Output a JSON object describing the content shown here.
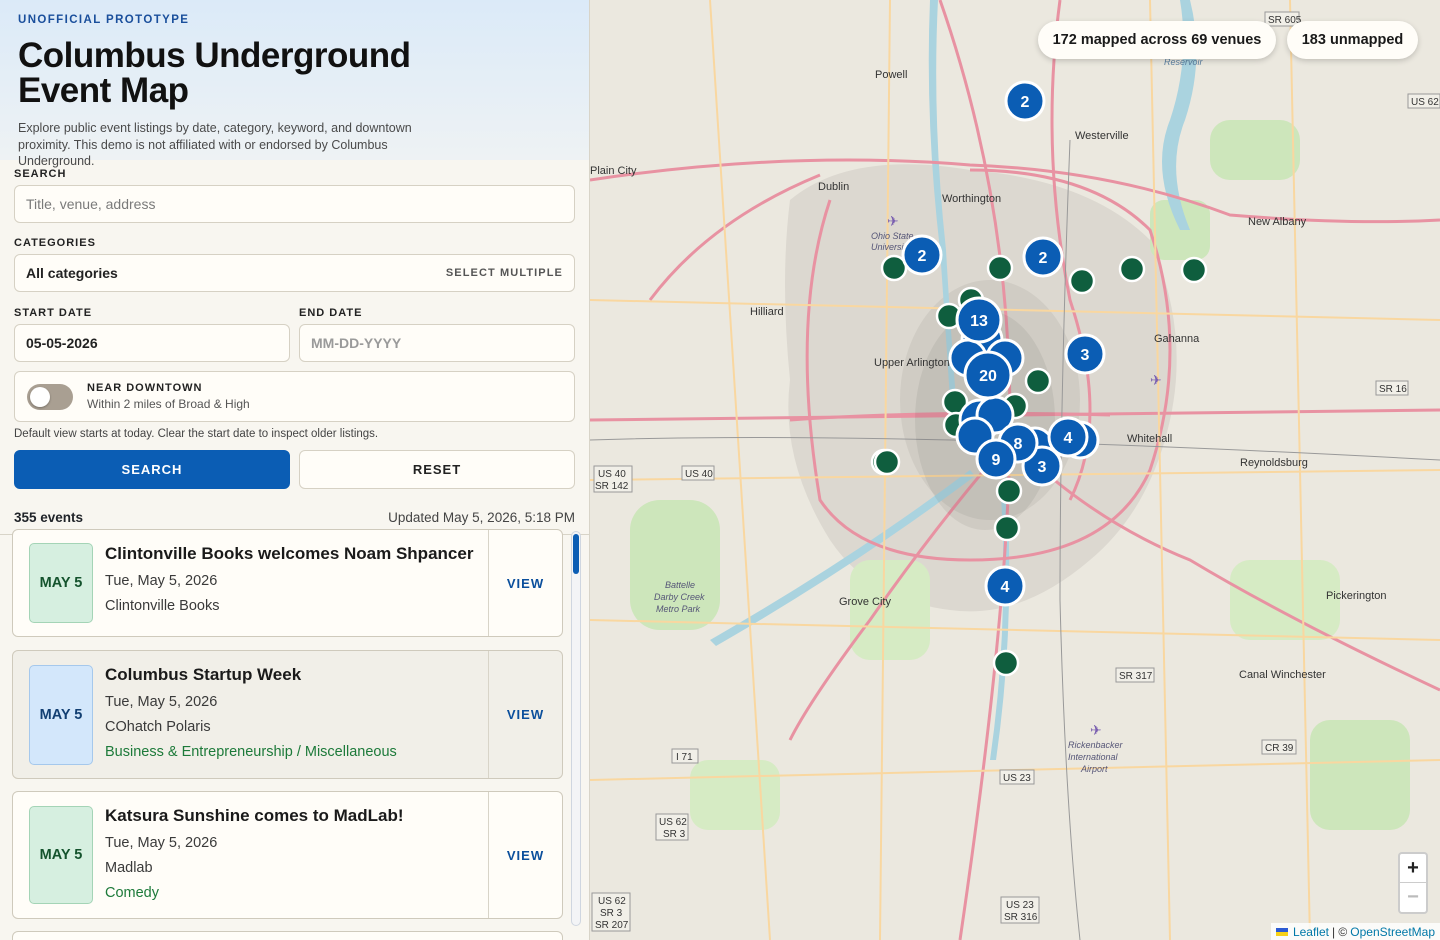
{
  "header": {
    "eyebrow": "UNOFFICIAL PROTOTYPE",
    "title": "Columbus Underground Event Map",
    "description": "Explore public event listings by date, category, keyword, and downtown proximity. This demo is not affiliated with or endorsed by Columbus Underground."
  },
  "search": {
    "label": "SEARCH",
    "placeholder": "Title, venue, address"
  },
  "categories": {
    "label": "CATEGORIES",
    "value": "All categories",
    "select_multiple": "SELECT MULTIPLE"
  },
  "dates": {
    "start_label": "START DATE",
    "start_value": "05-05-2026",
    "end_label": "END DATE",
    "end_placeholder": "MM-DD-YYYY"
  },
  "near_downtown": {
    "title": "NEAR DOWNTOWN",
    "subtitle": "Within 2 miles of Broad & High",
    "enabled": false
  },
  "hint": "Default view starts at today. Clear the start date to inspect older listings.",
  "buttons": {
    "search": "SEARCH",
    "reset": "RESET"
  },
  "results": {
    "count": "355 events",
    "updated": "Updated May 5, 2026, 5:18 PM"
  },
  "events": [
    {
      "badge": "MAY 5",
      "badge_color": "#d6efe0",
      "title": "Clintonville Books welcomes Noam Shpancer",
      "date": "Tue, May 5, 2026",
      "venue": "Clintonville Books",
      "categories": "",
      "action": "VIEW"
    },
    {
      "badge": "MAY 5",
      "badge_color": "#d3e7fb",
      "title": "Columbus Startup Week",
      "date": "Tue, May 5, 2026",
      "venue": "COhatch Polaris",
      "categories": "Business & Entrepreneurship / Miscellaneous",
      "action": "VIEW"
    },
    {
      "badge": "MAY 5",
      "badge_color": "#d6efe0",
      "title": "Katsura Sunshine comes to MadLab!",
      "date": "Tue, May 5, 2026",
      "venue": "Madlab",
      "categories": "Comedy",
      "action": "VIEW"
    }
  ],
  "map": {
    "mapped_summary": "172 mapped across 69 venues",
    "unmapped_summary": "183 unmapped",
    "zoom_in": "+",
    "zoom_out": "−",
    "attribution_leaflet": "Leaflet",
    "attribution_sep": "| ©",
    "attribution_osm": "OpenStreetMap",
    "cluster_counts": [
      "2",
      "2",
      "2",
      "13",
      "20",
      "3",
      "4",
      "8",
      "9",
      "3",
      "4"
    ],
    "colors": {
      "cluster": "#0b5db4",
      "single": "#0f5e3e",
      "motorway": "#e892a2",
      "primary": "#f9d7a0",
      "water": "#aad3df",
      "park": "#c9e4b4",
      "urban": "#d9d4cc"
    },
    "place_labels": [
      "Powell",
      "Westerville",
      "Plain City",
      "Dublin",
      "Worthington",
      "New Albany",
      "Hilliard",
      "Upper Arlington",
      "Gahanna",
      "Whitehall",
      "Reynoldsburg",
      "Grove City",
      "Pickerington",
      "Canal Winchester",
      "Ohio State University",
      "Battelle Darby Creek Metro Park",
      "Rickenbacker International Airport",
      "Reservoir"
    ],
    "route_labels": [
      "SR 605",
      "US 62",
      "US 40 SR 142",
      "US 40",
      "SR 16",
      "SR 317",
      "CR 39",
      "I 71",
      "US 23",
      "US 62 SR 3",
      "US 62 SR 3 SR 207",
      "US 23 SR 316"
    ]
  }
}
